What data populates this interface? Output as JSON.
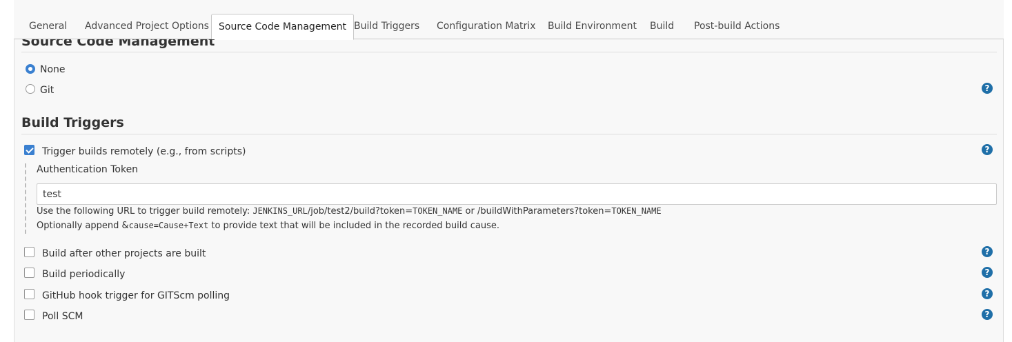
{
  "tabs": [
    {
      "label": "General"
    },
    {
      "label": "Advanced Project Options"
    },
    {
      "label": "Source Code Management"
    },
    {
      "label": "Build Triggers"
    },
    {
      "label": "Configuration Matrix"
    },
    {
      "label": "Build Environment"
    },
    {
      "label": "Build"
    },
    {
      "label": "Post-build Actions"
    }
  ],
  "active_tab": "Source Code Management",
  "scm": {
    "title": "Source Code Management",
    "options": [
      {
        "label": "None",
        "checked": true
      },
      {
        "label": "Git",
        "checked": false
      }
    ]
  },
  "build_triggers": {
    "title": "Build Triggers",
    "remote": {
      "label": "Trigger builds remotely (e.g., from scripts)",
      "checked": true,
      "auth_label": "Authentication Token",
      "auth_value": "test",
      "help_line1_prefix": "Use the following URL to trigger build remotely: ",
      "help_line1_code1": "JENKINS_URL",
      "help_line1_mid1": "/job/test2/build?token=",
      "help_line1_code2": "TOKEN_NAME",
      "help_line1_mid2": " or /buildWithParameters?token=",
      "help_line1_code3": "TOKEN_NAME",
      "help_line2_prefix": "Optionally append ",
      "help_line2_amp": "&",
      "help_line2_code": "cause=Cause+Text",
      "help_line2_suffix": " to provide text that will be included in the recorded build cause."
    },
    "others": [
      {
        "label": "Build after other projects are built",
        "checked": false
      },
      {
        "label": "Build periodically",
        "checked": false
      },
      {
        "label": "GitHub hook trigger for GITScm polling",
        "checked": false
      },
      {
        "label": "Poll SCM",
        "checked": false
      }
    ]
  },
  "help_glyph": "?",
  "colors": {
    "accent": "#3a80d0",
    "help": "#1f6fa8"
  }
}
